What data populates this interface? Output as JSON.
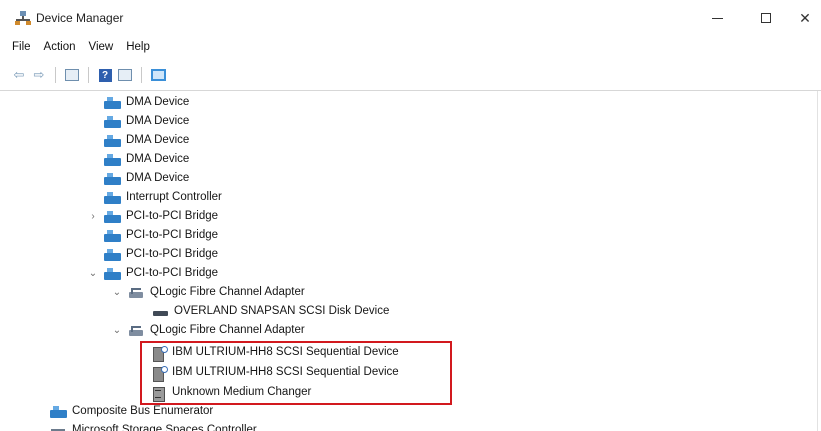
{
  "window": {
    "title": "Device Manager",
    "minimize_glyph": "",
    "close_glyph": "✕"
  },
  "menu": [
    "File",
    "Action",
    "View",
    "Help"
  ],
  "toolbar": {
    "back_glyph": "⇦",
    "forward_glyph": "⇨",
    "help_glyph": "?"
  },
  "tree": {
    "rows": [
      {
        "label": "DMA Device",
        "icon": "bus-device-icon",
        "expander": ""
      },
      {
        "label": "DMA Device",
        "icon": "bus-device-icon",
        "expander": ""
      },
      {
        "label": "DMA Device",
        "icon": "bus-device-icon",
        "expander": ""
      },
      {
        "label": "DMA Device",
        "icon": "bus-device-icon",
        "expander": ""
      },
      {
        "label": "DMA Device",
        "icon": "bus-device-icon",
        "expander": ""
      },
      {
        "label": "Interrupt Controller",
        "icon": "bus-device-icon",
        "expander": ""
      },
      {
        "label": "PCI-to-PCI Bridge",
        "icon": "bus-device-icon",
        "expander": "›"
      },
      {
        "label": "PCI-to-PCI Bridge",
        "icon": "bus-device-icon",
        "expander": ""
      },
      {
        "label": "PCI-to-PCI Bridge",
        "icon": "bus-device-icon",
        "expander": ""
      },
      {
        "label": "PCI-to-PCI Bridge",
        "icon": "bus-device-icon",
        "expander": "⌄"
      },
      {
        "label": "QLogic Fibre Channel Adapter",
        "icon": "fibre-adapter-icon",
        "expander": "⌄"
      },
      {
        "label": "OVERLAND SNAPSAN SCSI Disk Device",
        "icon": "disk-drive-icon",
        "expander": ""
      },
      {
        "label": "QLogic Fibre Channel Adapter",
        "icon": "fibre-adapter-icon",
        "expander": "⌄"
      },
      {
        "label": "IBM ULTRIUM-HH8 SCSI Sequential Device",
        "icon": "tape-drive-icon",
        "expander": ""
      },
      {
        "label": "IBM ULTRIUM-HH8 SCSI Sequential Device",
        "icon": "tape-drive-icon",
        "expander": ""
      },
      {
        "label": "Unknown Medium Changer",
        "icon": "medium-changer-icon",
        "expander": ""
      },
      {
        "label": "Composite Bus Enumerator",
        "icon": "bus-device-icon",
        "expander": ""
      },
      {
        "label": "Microsoft Storage Spaces Controller",
        "icon": "storage-controller-icon",
        "expander": ""
      }
    ]
  },
  "colors": {
    "highlight": "#d2191e",
    "device_blue": "#2f7fc7"
  }
}
